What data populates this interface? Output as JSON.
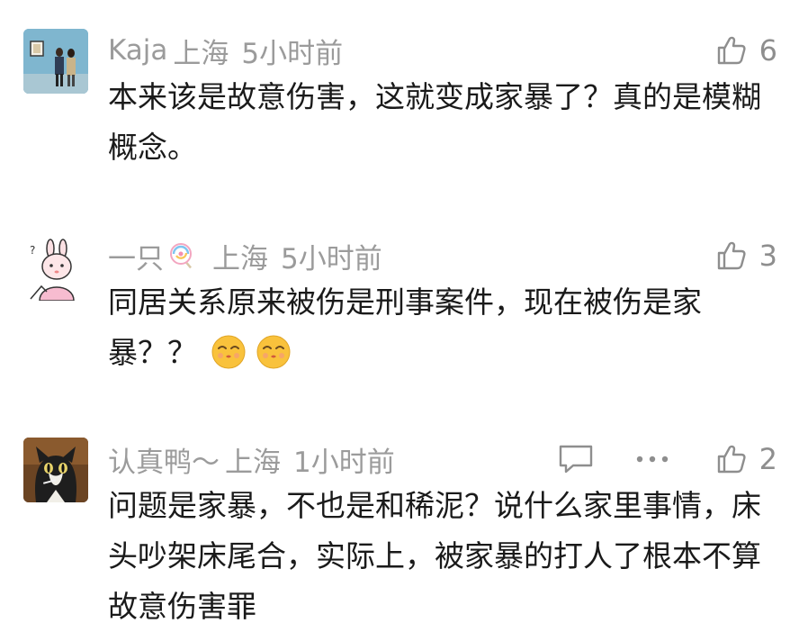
{
  "comments": [
    {
      "username": "Kaja",
      "location": "上海",
      "time": "5小时前",
      "likes": "6",
      "text": "本来该是故意伤害，这就变成家暴了？真的是模糊概念。",
      "avatar": "gallery-photo"
    },
    {
      "username": "一只",
      "username_emoji": "lollipop",
      "location": "上海",
      "time": "5小时前",
      "likes": "3",
      "text": "同居关系原来被伤是刑事案件，现在被伤是家暴？？",
      "text_emojis": [
        "kissing-face-with-closed-eyes",
        "kissing-face-with-closed-eyes"
      ],
      "avatar": "pink-bunny"
    },
    {
      "username": "认真鸭～",
      "location": "上海",
      "time": "1小时前",
      "likes": "2",
      "text": "问题是家暴，不也是和稀泥？说什么家里事情，床头吵架床尾合，实际上，被家暴的打人了根本不算故意伤害罪",
      "avatar": "cat-photo",
      "has_reply_icon": true,
      "has_more_icon": true
    }
  ],
  "colors": {
    "meta_gray": "#9b9b9b",
    "text": "#1a1a1a",
    "icon_gray": "#8e8e8e"
  }
}
